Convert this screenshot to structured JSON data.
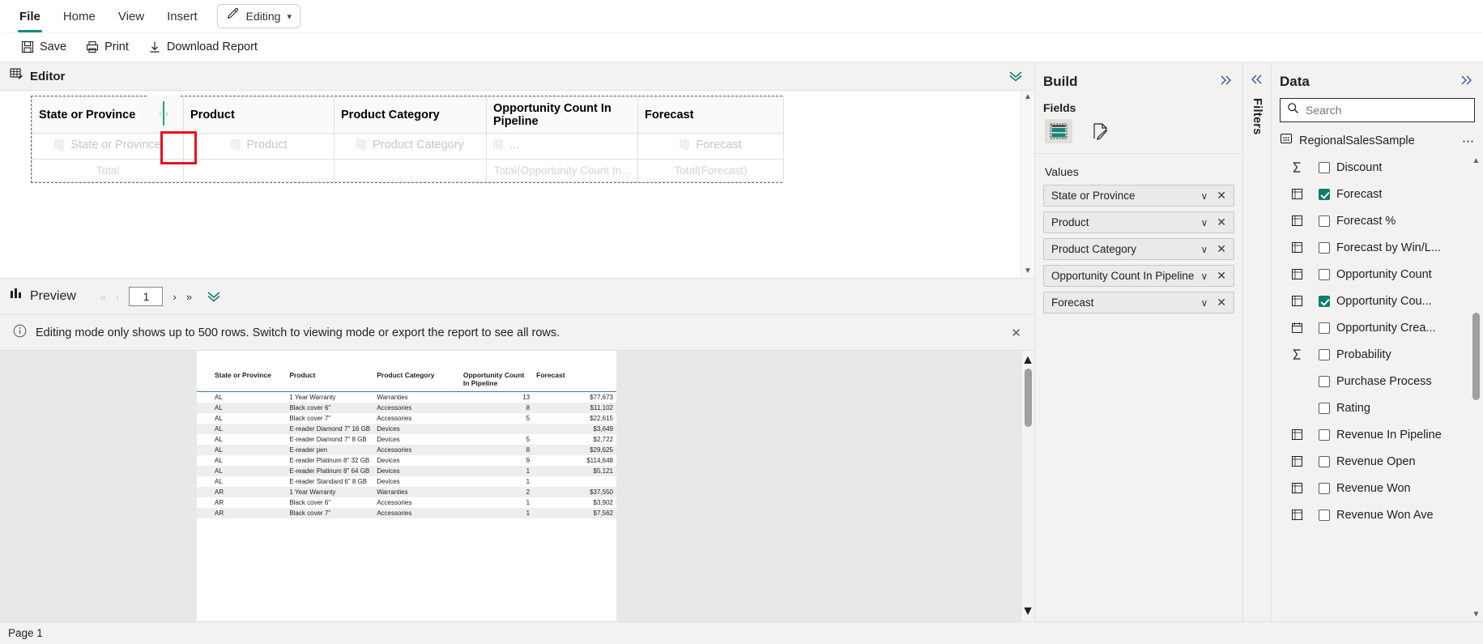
{
  "ribbon": {
    "tabs": [
      {
        "label": "File",
        "active": true
      },
      {
        "label": "Home",
        "active": false
      },
      {
        "label": "View",
        "active": false
      },
      {
        "label": "Insert",
        "active": false
      }
    ],
    "mode": {
      "label": "Editing",
      "icon": "pencil-icon"
    }
  },
  "commandbar": {
    "commands": [
      {
        "label": "Save",
        "icon": "save-icon"
      },
      {
        "label": "Print",
        "icon": "print-icon"
      },
      {
        "label": "Download Report",
        "icon": "download-icon"
      }
    ]
  },
  "editor": {
    "title": "Editor",
    "collapse_icon": "double-chevron-down-icon",
    "tablix": {
      "headers": [
        "State or Province",
        "Product",
        "Product Category",
        "Opportunity Count In Pipeline",
        "Forecast"
      ],
      "placeholders": [
        "State or Province",
        "Product",
        "Product Category",
        "...",
        "Forecast"
      ],
      "totals": [
        "Total",
        "",
        "",
        "Total(Opportunity Count In...",
        "Total(Forecast)"
      ]
    },
    "resize_handle": {
      "left_arrow": "‹",
      "right_arrow": "›",
      "accent": "#14a08b"
    },
    "annotation": {
      "color": "#e81123"
    }
  },
  "preview": {
    "title": "Preview",
    "collapse_icon": "double-chevron-down-icon",
    "pager": {
      "first": "«",
      "prev": "‹",
      "page": "1",
      "next": "›",
      "last": "»"
    },
    "banner": {
      "icon": "info-icon",
      "message": "Editing mode only shows up to 500 rows. Switch to viewing mode or export the report to see all rows.",
      "close": "✕"
    },
    "table": {
      "columns": [
        "State or Province",
        "Product",
        "Product Category",
        "Opportunity Count In Pipeline",
        "Forecast"
      ],
      "rows": [
        [
          "AL",
          "1 Year Warranty",
          "Warranties",
          "13",
          "$77,673"
        ],
        [
          "AL",
          "Black cover 6\"",
          "Accessories",
          "8",
          "$11,102"
        ],
        [
          "AL",
          "Black cover 7\"",
          "Accessories",
          "5",
          "$22,615"
        ],
        [
          "AL",
          "E-reader Diamond 7\" 16 GB",
          "Devices",
          "",
          "$3,649"
        ],
        [
          "AL",
          "E-reader Diamond 7\" 8 GB",
          "Devices",
          "5",
          "$2,722"
        ],
        [
          "AL",
          "E-reader pen",
          "Accessories",
          "8",
          "$29,625"
        ],
        [
          "AL",
          "E-reader Platinum 8\" 32 GB",
          "Devices",
          "9",
          "$114,648"
        ],
        [
          "AL",
          "E-reader Platinum 8\" 64 GB",
          "Devices",
          "1",
          "$5,121"
        ],
        [
          "AL",
          "E-reader Standard 6\" 8 GB",
          "Devices",
          "1",
          ""
        ],
        [
          "AR",
          "1 Year Warranty",
          "Warranties",
          "2",
          "$37,550"
        ],
        [
          "AR",
          "Black cover 6\"",
          "Accessories",
          "1",
          "$3,902"
        ],
        [
          "AR",
          "Black cover 7\"",
          "Accessories",
          "1",
          "$7,562"
        ]
      ]
    }
  },
  "build": {
    "title": "Build",
    "expand_icon": "double-chevron-right-icon",
    "fields_label": "Fields",
    "icons": [
      {
        "name": "table-fields-icon",
        "selected": true
      },
      {
        "name": "format-painter-icon",
        "selected": false
      }
    ],
    "values_label": "Values",
    "values": [
      {
        "label": "State or Province"
      },
      {
        "label": "Product"
      },
      {
        "label": "Product Category"
      },
      {
        "label": "Opportunity Count In Pipeline"
      },
      {
        "label": "Forecast"
      }
    ],
    "pill_chevron": "∨",
    "pill_remove": "✕"
  },
  "filters": {
    "collapse_icon": "double-chevron-left-icon",
    "label": "Filters"
  },
  "data": {
    "title": "Data",
    "expand_icon": "double-chevron-right-icon",
    "search": {
      "placeholder": "Search",
      "value": "",
      "icon": "search-icon"
    },
    "dataset": {
      "name": "RegionalSalesSample",
      "icon": "dataset-icon",
      "menu": "⋯"
    },
    "fields": [
      {
        "label": "Discount",
        "icon": "sigma-icon",
        "checked": false
      },
      {
        "label": "Forecast",
        "icon": "measure-icon",
        "checked": true
      },
      {
        "label": "Forecast %",
        "icon": "measure-icon",
        "checked": false
      },
      {
        "label": "Forecast by Win/L...",
        "icon": "measure-icon",
        "checked": false
      },
      {
        "label": "Opportunity Count",
        "icon": "measure-icon",
        "checked": false
      },
      {
        "label": "Opportunity Cou...",
        "icon": "measure-icon",
        "checked": true
      },
      {
        "label": "Opportunity Crea...",
        "icon": "calendar-icon",
        "checked": false
      },
      {
        "label": "Probability",
        "icon": "sigma-icon",
        "checked": false
      },
      {
        "label": "Purchase Process",
        "icon": "none",
        "checked": false
      },
      {
        "label": "Rating",
        "icon": "none",
        "checked": false
      },
      {
        "label": "Revenue In Pipeline",
        "icon": "measure-icon",
        "checked": false
      },
      {
        "label": "Revenue Open",
        "icon": "measure-icon",
        "checked": false
      },
      {
        "label": "Revenue Won",
        "icon": "measure-icon",
        "checked": false
      },
      {
        "label": "Revenue Won Ave",
        "icon": "measure-icon",
        "checked": false
      }
    ]
  },
  "statusbar": {
    "page_label": "Page 1"
  }
}
